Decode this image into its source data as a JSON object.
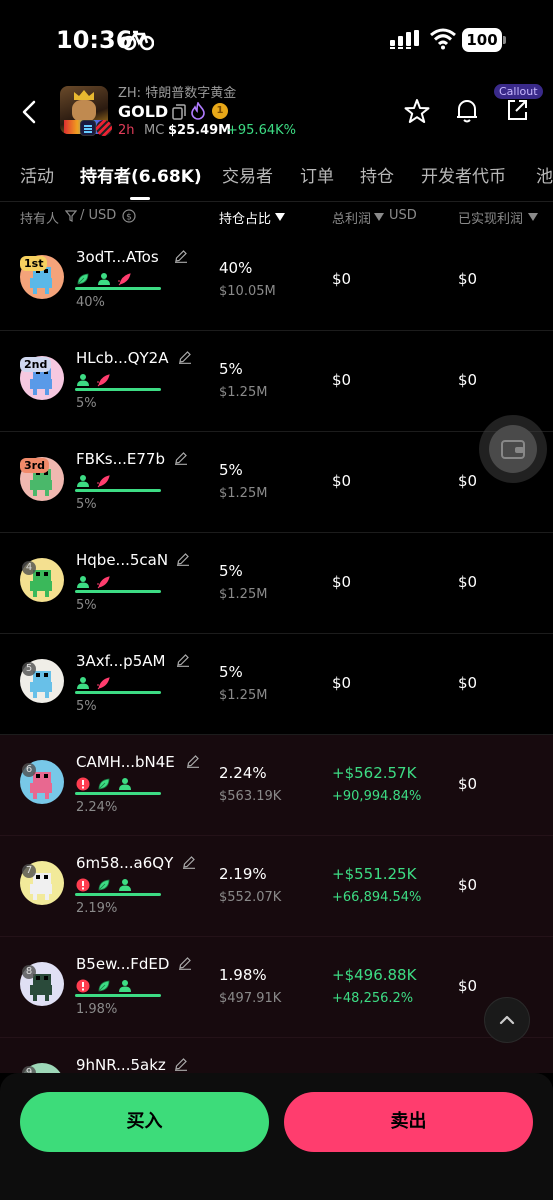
{
  "status": {
    "time": "10:36",
    "battery": "100"
  },
  "token": {
    "zh_name": "ZH: 特朗普数字黄金",
    "symbol": "GOLD",
    "age": "2h",
    "mc_label": "MC",
    "mc_value": "$25.49M",
    "mc_change": "+95.64K%",
    "callout": "Callout",
    "coin_glyph": "1"
  },
  "tabs": [
    "活动",
    "持有者(6.68K)",
    "交易者",
    "订单",
    "持仓",
    "开发者代币",
    "池"
  ],
  "active_tab": 1,
  "columns": {
    "holder": "持有人",
    "usd": "/ USD",
    "share": "持仓占比",
    "total_pnl": "总利润",
    "total_pnl_unit": "USD",
    "realized": "已实现利润"
  },
  "rows": [
    {
      "rank": "1st",
      "addr": "3odT...ATos",
      "pct": "40%",
      "share": "40%",
      "value": "$10.05M",
      "pnl": "$0",
      "realized": "$0"
    },
    {
      "rank": "2nd",
      "addr": "HLcb...QY2A",
      "pct": "5%",
      "share": "5%",
      "value": "$1.25M",
      "pnl": "$0",
      "realized": "$0"
    },
    {
      "rank": "3rd",
      "addr": "FBKs...E77b",
      "pct": "5%",
      "share": "5%",
      "value": "$1.25M",
      "pnl": "$0",
      "realized": "$0"
    },
    {
      "rank": "4",
      "addr": "Hqbe...5caN",
      "pct": "5%",
      "share": "5%",
      "value": "$1.25M",
      "pnl": "$0",
      "realized": "$0"
    },
    {
      "rank": "5",
      "addr": "3Axf...p5AM",
      "pct": "5%",
      "share": "5%",
      "value": "$1.25M",
      "pnl": "$0",
      "realized": "$0"
    },
    {
      "rank": "6",
      "addr": "CAMH...bN4E",
      "pct": "2.24%",
      "share": "2.24%",
      "value": "$563.19K",
      "pnl": "+$562.57K",
      "pnl_pct": "+90,994.84%",
      "realized": "$0"
    },
    {
      "rank": "7",
      "addr": "6m58...a6QY",
      "pct": "2.19%",
      "share": "2.19%",
      "value": "$552.07K",
      "pnl": "+$551.25K",
      "pnl_pct": "+66,894.54%",
      "realized": "$0"
    },
    {
      "rank": "8",
      "addr": "B5ew...FdED",
      "pct": "1.98%",
      "share": "1.98%",
      "value": "$497.91K",
      "pnl": "+$496.88K",
      "pnl_pct": "+48,256.2%",
      "realized": "$0"
    },
    {
      "rank": "9",
      "addr": "9hNR...5akz",
      "pct": "",
      "share": "",
      "value": "",
      "pnl": "",
      "realized": ""
    }
  ],
  "buttons": {
    "buy": "买入",
    "sell": "卖出"
  },
  "colors": {
    "green": "#3ddc84",
    "red": "#ff3d6e",
    "accent_pink": "#e23d5a"
  }
}
